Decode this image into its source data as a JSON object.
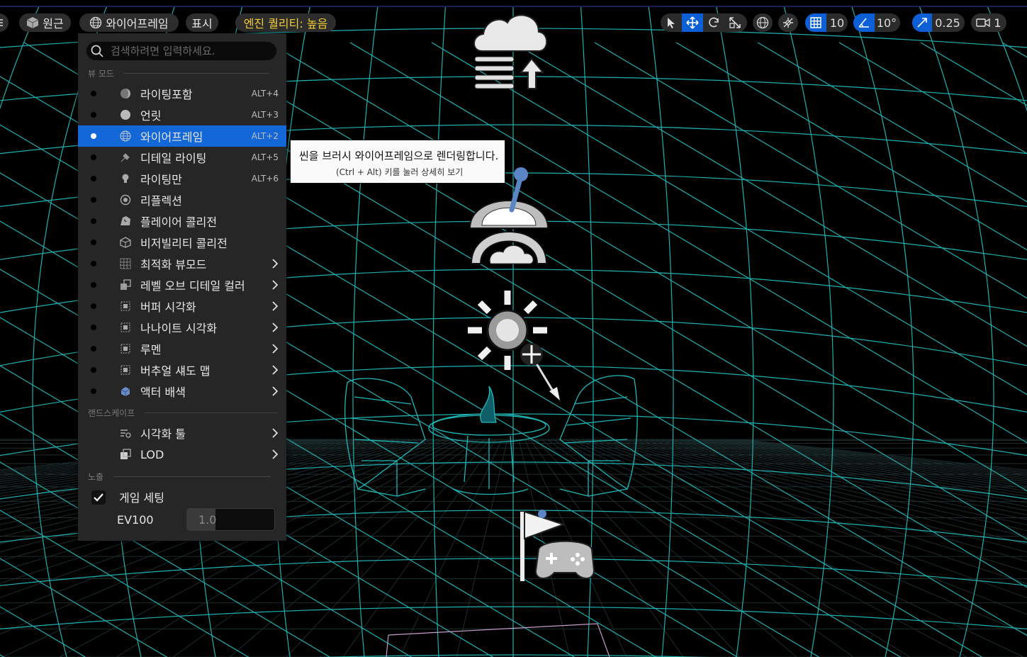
{
  "toolbar": {
    "perspective_label": "원근",
    "view_mode_label": "와이어프레임",
    "show_label": "표시",
    "quality_label": "엔진 퀄리티: 높음",
    "grid_snap_value": "10",
    "rotation_snap_value": "10°",
    "scale_snap_value": "0.25",
    "camera_speed_value": "1"
  },
  "menu": {
    "search_placeholder": "검색하려면 입력하세요.",
    "section_view_modes": "뷰 모드",
    "items": [
      {
        "label": "라이팅포함",
        "shortcut": "ALT+4",
        "icon": "lit-sphere-icon"
      },
      {
        "label": "언릿",
        "shortcut": "ALT+3",
        "icon": "unlit-sphere-icon"
      },
      {
        "label": "와이어프레임",
        "shortcut": "ALT+2",
        "icon": "wireframe-sphere-icon"
      },
      {
        "label": "디테일 라이팅",
        "shortcut": "ALT+5",
        "icon": "detail-lighting-icon"
      },
      {
        "label": "라이팅만",
        "shortcut": "ALT+6",
        "icon": "lightbulb-icon"
      },
      {
        "label": "리플렉션",
        "shortcut": "",
        "icon": "reflection-icon"
      },
      {
        "label": "플레이어 콜리전",
        "shortcut": "",
        "icon": "player-collision-icon"
      },
      {
        "label": "비저빌리티 콜리전",
        "shortcut": "",
        "icon": "visibility-collision-icon"
      },
      {
        "label": "최적화 뷰모드",
        "shortcut": "",
        "icon": "optimization-grid-icon"
      },
      {
        "label": "레벨 오브 디테일 컬러",
        "shortcut": "",
        "icon": "lod-coloration-icon"
      },
      {
        "label": "버퍼 시각화",
        "shortcut": "",
        "icon": "buffer-visualization-icon"
      },
      {
        "label": "나나이트 시각화",
        "shortcut": "",
        "icon": "nanite-visualization-icon"
      },
      {
        "label": "루멘",
        "shortcut": "",
        "icon": "lumen-icon"
      },
      {
        "label": "버추얼 섀도 맵",
        "shortcut": "",
        "icon": "virtual-shadow-map-icon"
      },
      {
        "label": "액터 배색",
        "shortcut": "",
        "icon": "actor-coloration-icon"
      }
    ],
    "selected_index": 2,
    "section_landscape": "랜드스케이프",
    "landscape_items": [
      {
        "label": "시각화 툴",
        "icon": "visualizer-icon"
      },
      {
        "label": "LOD",
        "icon": "lod-icon"
      }
    ],
    "section_exposure": "노출",
    "game_settings_label": "게임 세팅",
    "game_settings_checked": true,
    "ev100_label": "EV100",
    "ev100_value": "1.0"
  },
  "tooltip": {
    "line1": "씬을 브러시 와이어프레임으로 렌더링합니다.",
    "line2": "(Ctrl + Alt) 키를 눌러 상세히 보기"
  },
  "colors": {
    "wire_grid": "#1fb8b8",
    "selected": "#1467d6",
    "quality_text": "#f2cc33"
  }
}
